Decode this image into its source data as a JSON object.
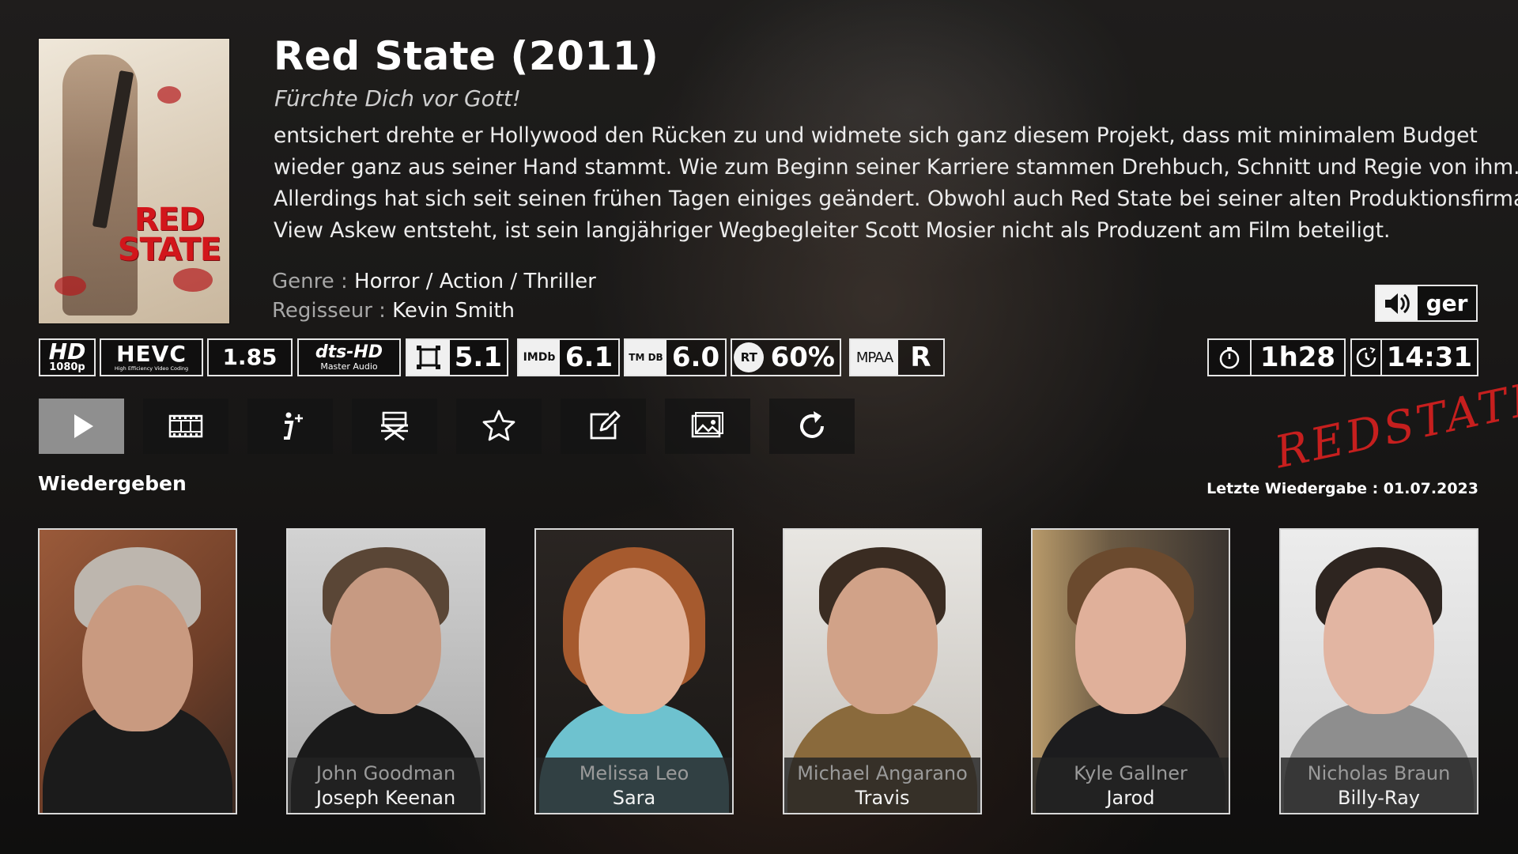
{
  "movie": {
    "title": "Red State (2011)",
    "tagline": "Fürchte Dich vor Gott!",
    "plot_lines": [
      "entsichert drehte er Hollywood den Rücken zu und widmete sich ganz diesem Projekt, dass mit minimalem Budget",
      "wieder ganz aus seiner Hand stammt. Wie zum Beginn seiner Karriere stammen Drehbuch, Schnitt und Regie von ihm.",
      "Allerdings hat sich seit seinen frühen Tagen einiges geändert. Obwohl auch Red State bei seiner alten Produktionsfirma",
      "View Askew entsteht, ist sein langjähriger Wegbegleiter Scott Mosier nicht als Produzent am Film beteiligt."
    ],
    "genre_label": "Genre : ",
    "genre": "Horror / Action / Thriller",
    "director_label": "Regisseur : ",
    "director": "Kevin Smith",
    "poster_title_1": "RED",
    "poster_title_2": "STATE",
    "logo_art": "REDSTATE"
  },
  "audio": {
    "icon": "speaker-icon",
    "language": "ger"
  },
  "flags": {
    "hd": "HD",
    "hd_res": "1080p",
    "codec": "HEVC",
    "codec_sub": "High Efficiency Video Coding",
    "aspect": "1.85",
    "audio_codec": "dts-HD",
    "audio_codec_sub": "Master Audio",
    "channels": "5.1",
    "imdb_label": "IMDb",
    "imdb_rating": "6.1",
    "tmdb_label": "TM DB",
    "tmdb_rating": "6.0",
    "rt_label": "RT",
    "rt_rating": "60%",
    "mpaa_label": "MPAA",
    "mpaa_rating": "R",
    "runtime": "1h28",
    "end_time": "14:31"
  },
  "buttons": [
    {
      "id": "play",
      "icon": "play-icon"
    },
    {
      "id": "trailer",
      "icon": "film-strip-icon"
    },
    {
      "id": "info",
      "icon": "info-plus-icon"
    },
    {
      "id": "director",
      "icon": "director-chair-icon"
    },
    {
      "id": "favorite",
      "icon": "star-icon"
    },
    {
      "id": "edit",
      "icon": "edit-icon"
    },
    {
      "id": "artwork",
      "icon": "images-icon"
    },
    {
      "id": "refresh",
      "icon": "refresh-icon"
    }
  ],
  "focused_button_label": "Wiedergeben",
  "last_played": "Letzte Wiedergabe : 01.07.2023",
  "cast": [
    {
      "name": "",
      "role": ""
    },
    {
      "name": "John Goodman",
      "role": "Joseph Keenan"
    },
    {
      "name": "Melissa Leo",
      "role": "Sara"
    },
    {
      "name": "Michael Angarano",
      "role": "Travis"
    },
    {
      "name": "Kyle Gallner",
      "role": "Jarod"
    },
    {
      "name": "Nicholas Braun",
      "role": "Billy-Ray"
    }
  ],
  "colors": {
    "accent_red": "#d2161b",
    "button_active": "#8f8f8f",
    "text_muted": "#a7a7a7"
  }
}
